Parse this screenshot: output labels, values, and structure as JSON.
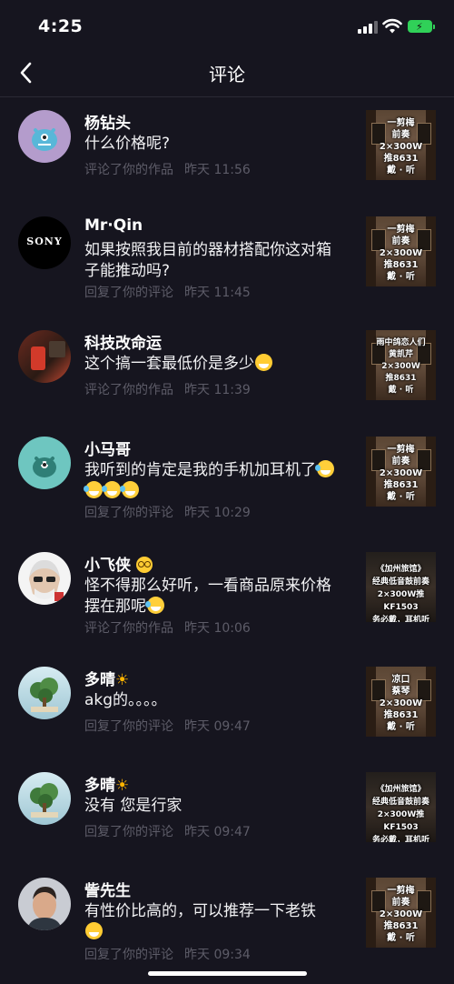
{
  "status": {
    "time": "4:25"
  },
  "nav": {
    "title": "评论"
  },
  "comments": [
    {
      "name": "杨钻头",
      "text": "什么价格呢?",
      "action": "评论了你的作品",
      "time": "昨天 11:56",
      "thumb_text": "一剪梅\n前奏\n2×300W\n推8631\n戴 · 听"
    },
    {
      "name": "Mr·Qin",
      "text": "如果按照我目前的器材搭配你这对箱子能推动吗?",
      "action": "回复了你的评论",
      "time": "昨天 11:45",
      "thumb_text": "一剪梅\n前奏\n2×300W\n推8631\n戴 · 听"
    },
    {
      "name": "科技改命运",
      "text": "这个搞一套最低价是多少",
      "action": "评论了你的作品",
      "time": "昨天 11:39",
      "thumb_text": "雨中鸽恋人们\n黄凯芹\n2×300W\n推8631\n戴 · 听"
    },
    {
      "name": "小马哥",
      "text": "我听到的肯定是我的手机加耳机了",
      "action": "回复了你的评论",
      "time": "昨天 10:29",
      "thumb_text": "一剪梅\n前奏\n2×300W\n推8631\n戴 · 听"
    },
    {
      "name": "小飞侠",
      "text": "怪不得那么好听，一看商品原来价格摆在那呢",
      "action": "评论了你的作品",
      "time": "昨天 10:06",
      "thumb_text": "《加州旅馆》\n经典低音鼓前奏\n2×300W推KF1503\n务必戴，耳机听"
    },
    {
      "name": "多晴",
      "text": "akg的。。。。",
      "action": "回复了你的评论",
      "time": "昨天 09:47",
      "thumb_text": "凉口\n蔡琴\n2×300W\n推8631\n戴 · 听"
    },
    {
      "name": "多晴",
      "text": "没有 您是行家",
      "action": "回复了你的评论",
      "time": "昨天 09:47",
      "thumb_text": "《加州旅馆》\n经典低音鼓前奏\n2×300W推KF1503\n务必戴，耳机听"
    },
    {
      "name": "訾先生",
      "text": "有性价比高的，可以推荐一下老铁",
      "action": "回复了你的评论",
      "time": "昨天 09:34",
      "thumb_text": "一剪梅\n前奏\n2×300W\n推8631\n戴 · 听"
    }
  ],
  "avatar_sony_label": "SONY",
  "colors": {
    "background": "#16151f",
    "meta": "#5d5c68",
    "battery": "#30d158"
  },
  "icons": {
    "back": "chevron-left-icon",
    "signal": "signal-icon",
    "wifi": "wifi-icon",
    "battery": "battery-charging-icon"
  }
}
